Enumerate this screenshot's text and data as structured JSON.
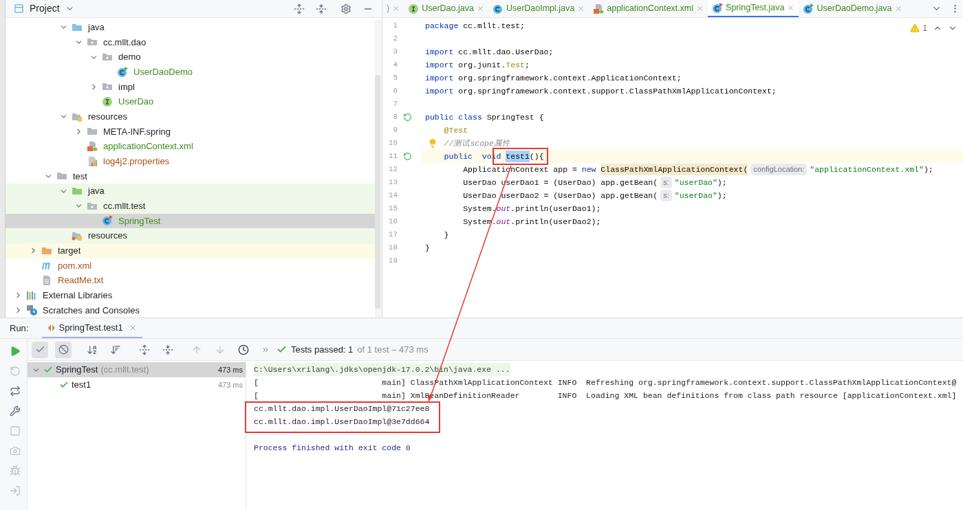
{
  "project_panel": {
    "title": "Project",
    "tree": [
      {
        "children": [
          {
            "children": [
              {
                "children": [
                  {
                    "label": "java",
                    "kind": "source-folder",
                    "expanded": true,
                    "children": [
                      {
                        "label": "cc.mllt.dao",
                        "kind": "package",
                        "expanded": true,
                        "children": [
                          {
                            "label": "demo",
                            "kind": "package",
                            "expanded": true,
                            "children": [
                              {
                                "label": "UserDaoDemo",
                                "kind": "runnable-class",
                                "color": "#3d8b1f"
                              }
                            ]
                          },
                          {
                            "label": "impl",
                            "kind": "package",
                            "expanded": false
                          },
                          {
                            "label": "UserDao",
                            "kind": "interface",
                            "color": "#3d8b1f"
                          }
                        ]
                      }
                    ]
                  },
                  {
                    "label": "resources",
                    "kind": "resources-folder",
                    "expanded": true,
                    "children": [
                      {
                        "label": "META-INF.spring",
                        "kind": "folder",
                        "expanded": false
                      },
                      {
                        "label": "applicationContext.xml",
                        "kind": "xml",
                        "color": "#3d8b1f"
                      },
                      {
                        "label": "log4j2.properties",
                        "kind": "properties",
                        "color": "#a9521b"
                      }
                    ]
                  }
                ]
              },
              {
                "label": "test",
                "kind": "folder",
                "expanded": true,
                "children": [
                  {
                    "label": "java",
                    "kind": "test-folder",
                    "expanded": true,
                    "test_source": true,
                    "children": [
                      {
                        "label": "cc.mllt.test",
                        "kind": "package",
                        "expanded": true,
                        "test_source": true,
                        "children": [
                          {
                            "label": "SpringTest",
                            "kind": "test-class",
                            "color": "#3d8b1f",
                            "selected": true
                          }
                        ]
                      }
                    ]
                  },
                  {
                    "label": "resources",
                    "kind": "test-resources-folder",
                    "test_source": true
                  }
                ]
              }
            ]
          },
          {
            "label": "target",
            "kind": "excluded-folder",
            "expanded": false,
            "excluded": true
          },
          {
            "label": "pom.xml",
            "kind": "maven",
            "color": "#a9521b"
          },
          {
            "label": "ReadMe.txt",
            "kind": "text",
            "color": "#a9521b"
          }
        ]
      },
      {
        "label": "External Libraries",
        "kind": "libraries",
        "expanded": false
      },
      {
        "label": "Scratches and Consoles",
        "kind": "scratches",
        "expanded": false
      }
    ]
  },
  "editor": {
    "tabs": [
      {
        "label": ")",
        "kind": "none",
        "color": "#9a9a9a",
        "selected": false
      },
      {
        "label": "UserDao.java",
        "kind": "interface",
        "color": "#3d8b1f",
        "selected": false
      },
      {
        "label": "UserDaoImpl.java",
        "kind": "class",
        "color": "#3d8b1f",
        "selected": false
      },
      {
        "label": "applicationContext.xml",
        "kind": "xml",
        "color": "#3d8b1f",
        "selected": false
      },
      {
        "label": "SpringTest.java",
        "kind": "test-class",
        "color": "#3d8b1f",
        "selected": true
      },
      {
        "label": "UserDaoDemo.java",
        "kind": "runnable-class",
        "color": "#3d8b1f",
        "selected": false
      }
    ],
    "warnings": "1",
    "lines": [
      {
        "number": "1",
        "segments": [
          {
            "text": "package",
            "kind": "keyword"
          },
          {
            "text": " cc.mllt.test;",
            "kind": "plain"
          }
        ]
      },
      {
        "number": "2"
      },
      {
        "number": "3",
        "segments": [
          {
            "text": "import",
            "kind": "keyword"
          },
          {
            "text": " cc.mllt.dao.UserDao;",
            "kind": "plain"
          }
        ]
      },
      {
        "number": "4",
        "segments": [
          {
            "text": "import",
            "kind": "keyword"
          },
          {
            "text": " org.junit.",
            "kind": "plain"
          },
          {
            "text": "Test",
            "kind": "annotation"
          },
          {
            "text": ";",
            "kind": "plain"
          }
        ]
      },
      {
        "number": "5",
        "segments": [
          {
            "text": "import",
            "kind": "keyword"
          },
          {
            "text": " org.springframework.context.ApplicationContext;",
            "kind": "plain"
          }
        ]
      },
      {
        "number": "6",
        "segments": [
          {
            "text": "import",
            "kind": "keyword"
          },
          {
            "text": " org.springframework.context.support.ClassPathXmlApplicationContext;",
            "kind": "plain"
          }
        ]
      },
      {
        "number": "7"
      },
      {
        "number": "8",
        "kind": "run",
        "segments": [
          {
            "text": "public class",
            "kind": "keyword"
          },
          {
            "text": " SpringTest {",
            "kind": "plain"
          }
        ]
      },
      {
        "number": "9",
        "segments": [
          {
            "text": "    @Test",
            "kind": "annotation"
          }
        ]
      },
      {
        "number": "10",
        "kind": "bulb",
        "segments": [
          {
            "text": "    //测试scope属性",
            "kind": "comment"
          }
        ]
      },
      {
        "number": "11",
        "kind": "run",
        "current": true,
        "segments": [
          {
            "text": "    public  void ",
            "kind": "keyword"
          },
          {
            "text": "test1",
            "kind": "selection"
          },
          {
            "text": "(){",
            "kind": "plain"
          }
        ]
      },
      {
        "number": "12",
        "segments": [
          {
            "text": "        ApplicationContext app = ",
            "kind": "plain"
          },
          {
            "text": "new ",
            "kind": "keyword"
          },
          {
            "text": "ClassPathXmlApplicationContext(",
            "kind": "match"
          },
          {
            "text": "configLocation:",
            "kind": "hint"
          },
          {
            "text": "\"applicationContext.xml\"",
            "kind": "string"
          },
          {
            "text": ");",
            "kind": "plain"
          }
        ]
      },
      {
        "number": "13",
        "segments": [
          {
            "text": "        UserDao userDao1 = (UserDao) app.getBean(",
            "kind": "plain"
          },
          {
            "text": "s:",
            "kind": "hint"
          },
          {
            "text": "\"userDao\"",
            "kind": "string"
          },
          {
            "text": ");",
            "kind": "plain"
          }
        ]
      },
      {
        "number": "14",
        "segments": [
          {
            "text": "        UserDao userDao2 = (UserDao) app.getBean(",
            "kind": "plain"
          },
          {
            "text": "s:",
            "kind": "hint"
          },
          {
            "text": "\"userDao\"",
            "kind": "string"
          },
          {
            "text": ");",
            "kind": "plain"
          }
        ]
      },
      {
        "number": "15",
        "segments": [
          {
            "text": "        System.",
            "kind": "plain"
          },
          {
            "text": "out",
            "kind": "field"
          },
          {
            "text": ".println(userDao1);",
            "kind": "plain"
          }
        ]
      },
      {
        "number": "16",
        "segments": [
          {
            "text": "        System.",
            "kind": "plain"
          },
          {
            "text": "out",
            "kind": "field"
          },
          {
            "text": ".println(userDao2);",
            "kind": "plain"
          }
        ]
      },
      {
        "number": "17",
        "segments": [
          {
            "text": "    }",
            "kind": "plain"
          }
        ]
      },
      {
        "number": "18",
        "segments": [
          {
            "text": "}",
            "kind": "plain"
          }
        ]
      },
      {
        "number": "19"
      }
    ]
  },
  "run_panel": {
    "title": "Run:",
    "tab": "SpringTest.test1",
    "side_tools": [
      {
        "kind": "run",
        "disabled": false
      },
      {
        "kind": "rerun-failed",
        "disabled": true
      },
      {
        "kind": "toggle-auto",
        "disabled": false
      },
      {
        "kind": "settings",
        "disabled": false
      },
      {
        "kind": "stop",
        "disabled": true
      },
      {
        "kind": "snapshot",
        "disabled": true
      },
      {
        "kind": "debug",
        "disabled": true
      },
      {
        "kind": "exit",
        "disabled": true
      }
    ],
    "toggles": [
      {
        "kind": "show-passed",
        "on": true
      },
      {
        "kind": "show-ignored",
        "on": true
      }
    ],
    "summary": "Tests passed: 1",
    "summary_detail": "of 1 test – 473 ms",
    "results": [
      {
        "name": "SpringTest",
        "package": "(cc.mllt.test)",
        "time": "473 ms",
        "selected": true,
        "children": [
          {
            "name": "test1",
            "time": "473 ms",
            "selected": false
          }
        ]
      }
    ],
    "console": [
      {
        "kind": "command",
        "text": "C:\\Users\\xrilang\\.jdks\\openjdk-17.0.2\\bin\\java.exe ..."
      },
      {
        "kind": "log",
        "text": "[                          main] ClassPathXmlApplicationContext INFO  Refreshing org.springframework.context.support.ClassPathXmlApplicationContext@"
      },
      {
        "kind": "log",
        "text": "[                          main] XmlBeanDefinitionReader        INFO  Loading XML bean definitions from class path resource [applicationContext.xml]"
      },
      {
        "kind": "output",
        "text": "cc.mllt.dao.impl.UserDaoImpl@71c27ee8"
      },
      {
        "kind": "output",
        "text": "cc.mllt.dao.impl.UserDaoImpl@3e7dd664"
      },
      {
        "kind": "exit",
        "text": "Process finished with exit code 0"
      }
    ]
  }
}
